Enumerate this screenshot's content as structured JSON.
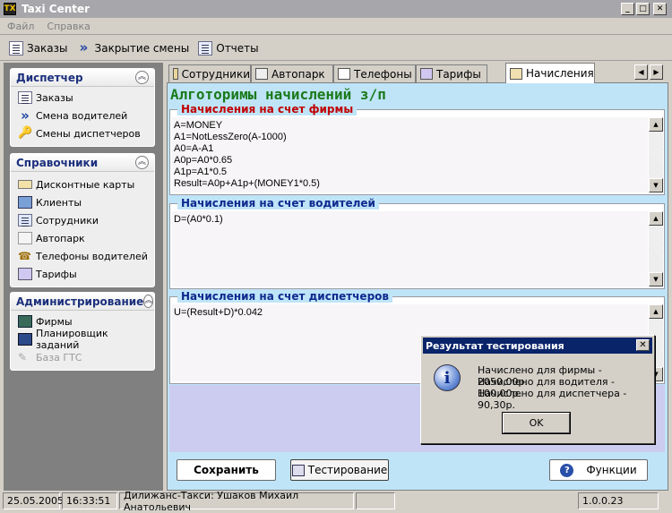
{
  "window": {
    "title": "Taxi Center",
    "icon_text": "TX",
    "minimize": "_",
    "maximize": "□",
    "close": "✕"
  },
  "menu": [
    "Файл",
    "Справка"
  ],
  "toolbar": [
    {
      "label": "Заказы",
      "icon": "list-icon"
    },
    {
      "label": "Закрытие смены",
      "icon": "double-arrow-icon"
    },
    {
      "label": "Отчеты",
      "icon": "report-icon"
    }
  ],
  "sidebar": {
    "groups": [
      {
        "title": "Диспетчер",
        "items": [
          {
            "label": "Заказы",
            "icon": "list-icon",
            "enabled": true
          },
          {
            "label": "Смена водителей",
            "icon": "double-arrow-icon",
            "enabled": true
          },
          {
            "label": "Смены диспетчеров",
            "icon": "keys-icon",
            "enabled": true
          }
        ]
      },
      {
        "title": "Справочники",
        "items": [
          {
            "label": "Дисконтные карты",
            "icon": "card-icon",
            "enabled": true
          },
          {
            "label": "Клиенты",
            "icon": "clients-icon",
            "enabled": true
          },
          {
            "label": "Сотрудники",
            "icon": "employees-icon",
            "enabled": true
          },
          {
            "label": "Автопарк",
            "icon": "car-icon",
            "enabled": true
          },
          {
            "label": "Телефоны водителей",
            "icon": "phone-icon",
            "enabled": true
          },
          {
            "label": "Тарифы",
            "icon": "tariff-icon",
            "enabled": true
          }
        ]
      },
      {
        "title": "Администрирование",
        "items": [
          {
            "label": "Фирмы",
            "icon": "firms-icon",
            "enabled": true
          },
          {
            "label": "Планировщик заданий",
            "icon": "scheduler-icon",
            "enabled": true
          },
          {
            "label": "База ГТС",
            "icon": "database-icon",
            "enabled": false
          }
        ]
      }
    ],
    "collapse_glyph": "︽"
  },
  "tabs": [
    {
      "label": "Сотрудники",
      "active": false
    },
    {
      "label": "Автопарк",
      "active": false
    },
    {
      "label": "Телефоны",
      "active": false
    },
    {
      "label": "Тарифы",
      "active": false
    },
    {
      "label": "Начисления",
      "active": true
    }
  ],
  "tab_scroll": {
    "left": "◀",
    "right": "▶"
  },
  "page": {
    "title": "Алготоримы начислений з/п",
    "sections": [
      {
        "label": "Начисления на счет фирмы",
        "code": "A=MONEY\nA1=NotLessZero(A-1000)\nA0=A-A1\nA0p=A0*0.65\nA1p=A1*0.5\nResult=A0p+A1p+(MONEY1*0.5)"
      },
      {
        "label": "Начисления на счет водителей",
        "code": "D=(A0*0.1)"
      },
      {
        "label": "Начисления на счет диспетчеров",
        "code": "U=(Result+D)*0.042"
      }
    ],
    "scroll_up": "▲",
    "scroll_down": "▼"
  },
  "buttons": {
    "save": "Сохранить",
    "test": "Тестирование",
    "functions": "Функции"
  },
  "dialog": {
    "title": "Результат тестирования",
    "close": "✕",
    "icon_glyph": "i",
    "lines": [
      "Начислено для фирмы - 2050,00р.",
      "Начислено для водителя - 100,00р.",
      "Начислено для диспетчера - 90,30р."
    ],
    "ok": "OK"
  },
  "status": {
    "date": "25.05.2005",
    "time": "16:33:51",
    "user": "Дилижанс-Такси: Ушаков Михаил Анатольевич",
    "version": "1.0.0.23"
  }
}
